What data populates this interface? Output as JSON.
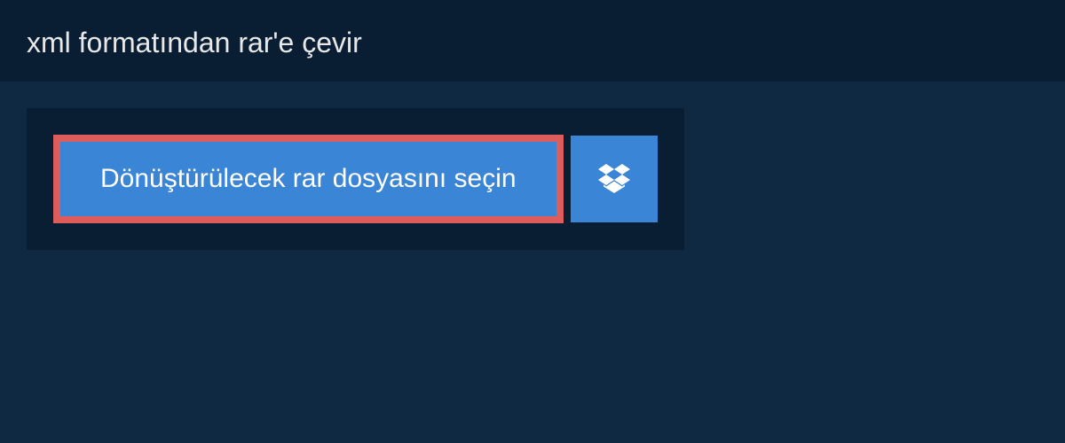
{
  "header": {
    "title": "xml formatından rar'e çevir"
  },
  "upload": {
    "select_label": "Dönüştürülecek rar dosyasını seçin"
  }
}
